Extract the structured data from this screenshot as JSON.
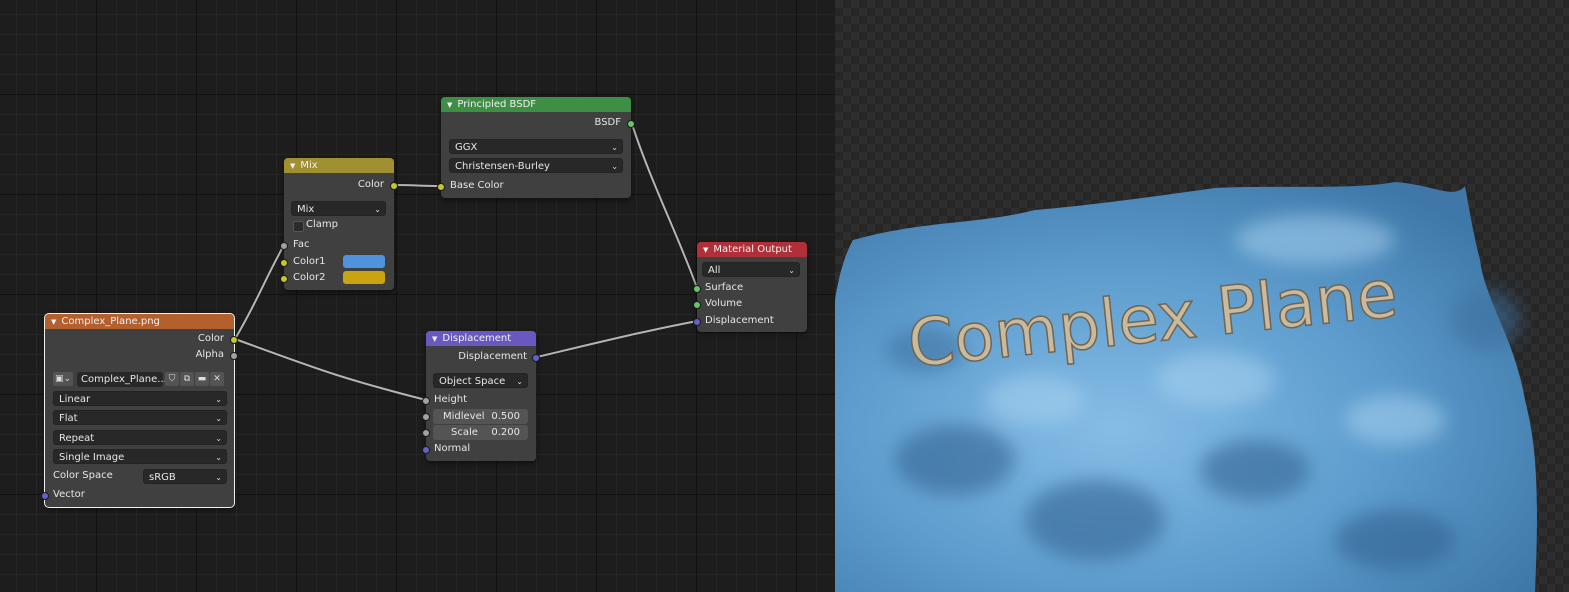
{
  "image_node": {
    "title": "Complex_Plane.png",
    "outputs": [
      "Color",
      "Alpha"
    ],
    "image_name": "Complex_Plane....",
    "interpolation": "Linear",
    "projection": "Flat",
    "extension": "Repeat",
    "source": "Single Image",
    "color_space_label": "Color Space",
    "color_space": "sRGB",
    "input_vector": "Vector",
    "header_color": "#b4602e"
  },
  "mix_node": {
    "title": "Mix",
    "output": "Color",
    "blend_type": "Mix",
    "clamp_label": "Clamp",
    "inputs": [
      "Fac",
      "Color1",
      "Color2"
    ],
    "color1": "#4f93dc",
    "color2": "#c9a312",
    "header_color": "#a09032"
  },
  "bsdf_node": {
    "title": "Principled BSDF",
    "output": "BSDF",
    "distribution": "GGX",
    "subsurface_method": "Christensen-Burley",
    "input": "Base Color",
    "header_color": "#3e8e45"
  },
  "displacement_node": {
    "title": "Displacement",
    "output": "Displacement",
    "space": "Object Space",
    "input_height": "Height",
    "midlevel_label": "Midlevel",
    "midlevel_value": "0.500",
    "scale_label": "Scale",
    "scale_value": "0.200",
    "input_normal": "Normal",
    "header_color": "#6a58c0"
  },
  "output_node": {
    "title": "Material Output",
    "target": "All",
    "inputs": [
      "Surface",
      "Volume",
      "Displacement"
    ],
    "header_color": "#b0303a"
  },
  "viewport": {
    "rendered_text": "Complex Plane",
    "surface_color": "#6ea6d4"
  }
}
